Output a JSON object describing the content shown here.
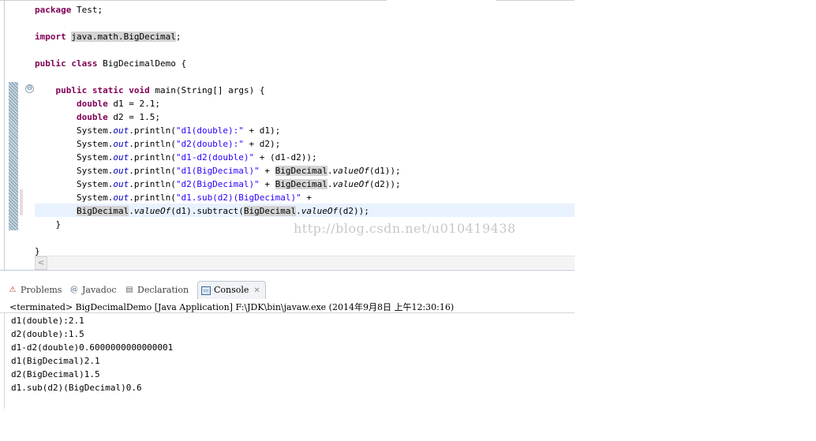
{
  "editor": {
    "lines": [
      [
        {
          "t": "package",
          "c": "kw"
        },
        {
          "t": " Test;"
        }
      ],
      [],
      [
        {
          "t": "import",
          "c": "kw"
        },
        {
          "t": " "
        },
        {
          "t": "java.math.BigDecimal",
          "c": "hl"
        },
        {
          "t": ";"
        }
      ],
      [],
      [
        {
          "t": "public",
          "c": "kw"
        },
        {
          "t": " "
        },
        {
          "t": "class",
          "c": "kw"
        },
        {
          "t": " BigDecimalDemo {"
        }
      ],
      [],
      [
        {
          "t": "    "
        },
        {
          "t": "public",
          "c": "kw"
        },
        {
          "t": " "
        },
        {
          "t": "static",
          "c": "kw"
        },
        {
          "t": " "
        },
        {
          "t": "void",
          "c": "kw"
        },
        {
          "t": " main(String[] args) {"
        }
      ],
      [
        {
          "t": "        "
        },
        {
          "t": "double",
          "c": "kw"
        },
        {
          "t": " d1 = 2.1;"
        }
      ],
      [
        {
          "t": "        "
        },
        {
          "t": "double",
          "c": "kw"
        },
        {
          "t": " d2 = 1.5;"
        }
      ],
      [
        {
          "t": "        System."
        },
        {
          "t": "out",
          "c": "stat"
        },
        {
          "t": ".println("
        },
        {
          "t": "\"d1(double):\"",
          "c": "str"
        },
        {
          "t": " + d1);"
        }
      ],
      [
        {
          "t": "        System."
        },
        {
          "t": "out",
          "c": "stat"
        },
        {
          "t": ".println("
        },
        {
          "t": "\"d2(double):\"",
          "c": "str"
        },
        {
          "t": " + d2);"
        }
      ],
      [
        {
          "t": "        System."
        },
        {
          "t": "out",
          "c": "stat"
        },
        {
          "t": ".println("
        },
        {
          "t": "\"d1-d2(double)\"",
          "c": "str"
        },
        {
          "t": " + (d1-d2));"
        }
      ],
      [
        {
          "t": "        System."
        },
        {
          "t": "out",
          "c": "stat"
        },
        {
          "t": ".println("
        },
        {
          "t": "\"d1(BigDecimal)\"",
          "c": "str"
        },
        {
          "t": " + "
        },
        {
          "t": "BigDecimal",
          "c": "hl"
        },
        {
          "t": "."
        },
        {
          "t": "valueOf",
          "c": "mth"
        },
        {
          "t": "(d1));"
        }
      ],
      [
        {
          "t": "        System."
        },
        {
          "t": "out",
          "c": "stat"
        },
        {
          "t": ".println("
        },
        {
          "t": "\"d2(BigDecimal)\"",
          "c": "str"
        },
        {
          "t": " + "
        },
        {
          "t": "BigDecimal",
          "c": "hl"
        },
        {
          "t": "."
        },
        {
          "t": "valueOf",
          "c": "mth"
        },
        {
          "t": "(d2));"
        }
      ],
      [
        {
          "t": "        System."
        },
        {
          "t": "out",
          "c": "stat"
        },
        {
          "t": ".println("
        },
        {
          "t": "\"d1.sub(d2)(BigDecimal)\"",
          "c": "str"
        },
        {
          "t": " +"
        }
      ],
      [
        {
          "t": "        "
        },
        {
          "t": "BigDecimal",
          "c": "hl"
        },
        {
          "t": "."
        },
        {
          "t": "valueOf",
          "c": "mth"
        },
        {
          "t": "(d1).subtract("
        },
        {
          "t": "BigDecimal",
          "c": "hl"
        },
        {
          "t": "."
        },
        {
          "t": "valueOf",
          "c": "mth"
        },
        {
          "t": "(d2));"
        }
      ],
      [
        {
          "t": "    }"
        }
      ],
      [],
      [
        {
          "t": "}"
        }
      ]
    ],
    "fold_icon": "⊖",
    "watermark": "http://blog.csdn.net/u010419438",
    "scroll_left_icon": "<"
  },
  "tabs": {
    "problems": {
      "label": "Problems",
      "icon": "problems-icon",
      "glyph": "⚠"
    },
    "javadoc": {
      "label": "Javadoc",
      "icon": "javadoc-icon",
      "glyph": "@"
    },
    "declaration": {
      "label": "Declaration",
      "icon": "declaration-icon",
      "glyph": "▤"
    },
    "console": {
      "label": "Console",
      "icon": "console-icon",
      "glyph": "▭",
      "close": "✕"
    }
  },
  "console": {
    "header": "<terminated> BigDecimalDemo [Java Application] F:\\JDK\\bin\\javaw.exe (2014年9月8日 上午12:30:16)",
    "output": [
      "d1(double):2.1",
      "d2(double):1.5",
      "d1-d2(double)0.6000000000000001",
      "d1(BigDecimal)2.1",
      "d2(BigDecimal)1.5",
      "d1.sub(d2)(BigDecimal)0.6"
    ]
  },
  "colors": {
    "keyword": "#7f0055",
    "string": "#2a00ff",
    "static_field": "#0000c0",
    "current_line": "#e8f2fe",
    "occurrence_highlight": "#d4d4d4"
  }
}
